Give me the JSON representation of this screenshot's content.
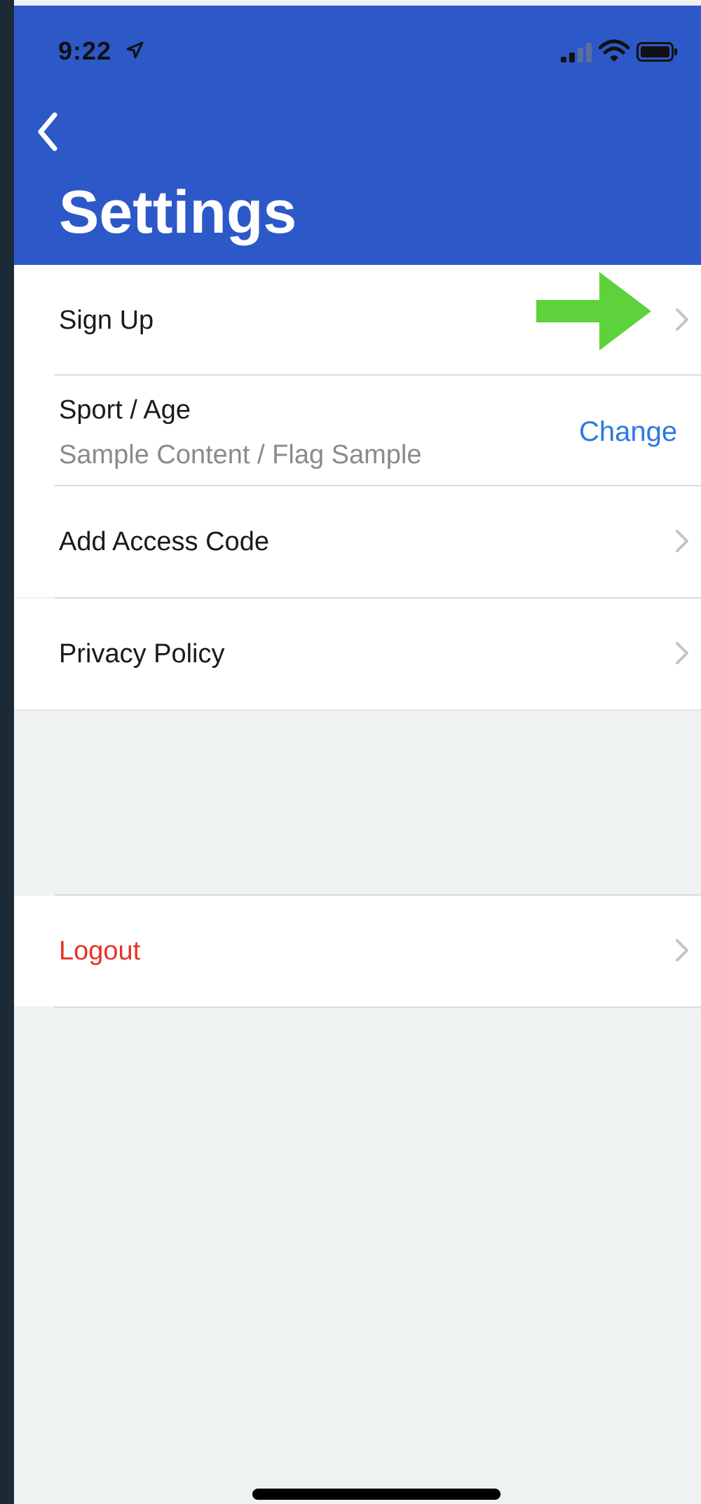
{
  "status_bar": {
    "time": "9:22"
  },
  "header": {
    "title": "Settings"
  },
  "settings_items": {
    "sign_up": {
      "label": "Sign Up"
    },
    "sport_age": {
      "label": "Sport / Age",
      "value": "Sample Content / Flag Sample",
      "action_label": "Change"
    },
    "add_access_code": {
      "label": "Add Access Code"
    },
    "privacy_policy": {
      "label": "Privacy Policy"
    },
    "logout": {
      "label": "Logout"
    }
  },
  "colors": {
    "header_bg": "#2d58c8",
    "accent_link": "#2a7ae2",
    "destructive": "#e5332a",
    "arrow_highlight": "#5ed23a"
  },
  "icons": {
    "back": "chevron-left-icon",
    "row_disclosure": "chevron-right-icon",
    "annotation": "arrow-right-icon"
  }
}
